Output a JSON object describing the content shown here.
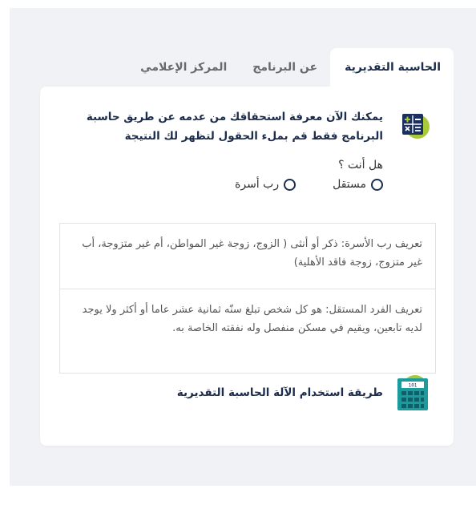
{
  "tabs": [
    {
      "label": "الحاسبة التقديرية",
      "active": true
    },
    {
      "label": "عن البرنامج",
      "active": false
    },
    {
      "label": "المركز الإعلامي",
      "active": false
    }
  ],
  "intro": {
    "line1": "يمكنك الآن معرفة استحقاقك من عدمه عن طريق حاسبة",
    "line2": "البرنامج فقط قم بملء الحقول لتظهر لك النتيجة"
  },
  "question": "هل أنت ؟",
  "options": [
    {
      "label": "مستقل",
      "selected": false
    },
    {
      "label": "رب أسرة",
      "selected": false
    }
  ],
  "definitions": {
    "family_head": "تعريف رب الأسرة: ذكر أو أنثى ( الزوج، زوجة غير المواطن، أم غير متزوجة، أب غير متزوج، زوجة فاقد الأهلية)",
    "independent": "تعريف الفرد المستقل: هو كل شخص تبلغ سنّه ثمانية عشر عاما أو أكثر ولا يوجد لديه تابعين، ويقيم في مسكن منفصل وله نفقته الخاصة به."
  },
  "howto": {
    "label": "طريقة استخدام الآلة الحاسبة التقديرية",
    "icon": "calculator-icon"
  },
  "icons": {
    "intro": "math-operations-icon"
  },
  "colors": {
    "primary": "#1c2c4c",
    "accent_green": "#a8c93a",
    "accent_teal": "#1b9b9b",
    "background": "#f1f2f5"
  }
}
